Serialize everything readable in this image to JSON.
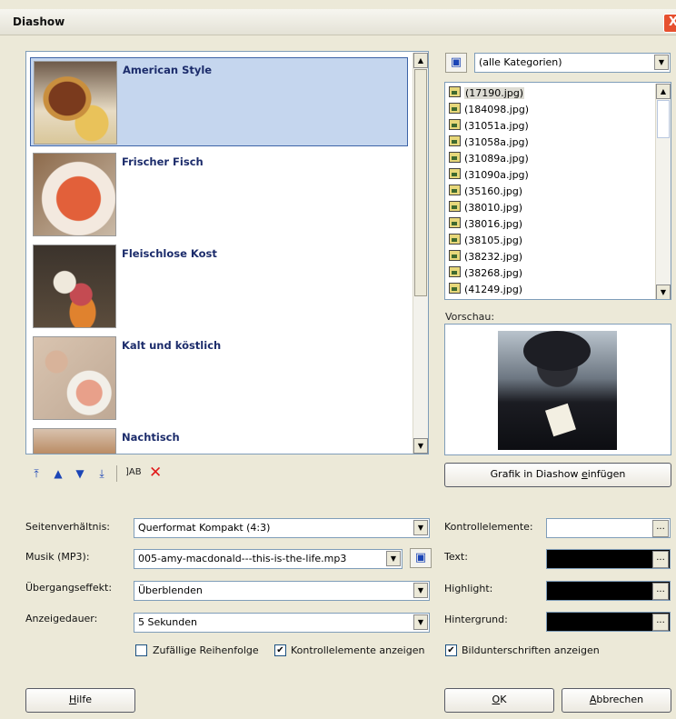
{
  "window": {
    "title": "Diashow",
    "close_glyph": "X"
  },
  "slides": [
    {
      "label": "American Style",
      "selected": true
    },
    {
      "label": "Frischer Fisch",
      "selected": false
    },
    {
      "label": "Fleischlose Kost",
      "selected": false
    },
    {
      "label": "Kalt und köstlich",
      "selected": false
    },
    {
      "label": "Nachtisch",
      "selected": false
    }
  ],
  "list_toolbar": {
    "rename_label": "]AB",
    "delete_label": "✕"
  },
  "category": {
    "selected": "(alle Kategorien)"
  },
  "files": [
    "(17190.jpg)",
    "(184098.jpg)",
    "(31051a.jpg)",
    "(31058a.jpg)",
    "(31089a.jpg)",
    "(31090a.jpg)",
    "(35160.jpg)",
    "(38010.jpg)",
    "(38016.jpg)",
    "(38105.jpg)",
    "(38232.jpg)",
    "(38268.jpg)",
    "(41249.jpg)"
  ],
  "preview": {
    "label": "Vorschau:"
  },
  "insert_button": {
    "pre": "Grafik in Diashow ",
    "underlined": "e",
    "post": "infügen"
  },
  "settings": {
    "aspect_label": "Seitenverhältnis:",
    "aspect_value": "Querformat Kompakt (4:3)",
    "music_label": "Musik (MP3):",
    "music_value": "005-amy-macdonald---this-is-the-life.mp3",
    "transition_label": "Übergangseffekt:",
    "transition_value": "Überblenden",
    "duration_label": "Anzeigedauer:",
    "duration_value": "5 Sekunden"
  },
  "colors_section": {
    "controls_label": "Kontrollelemente:",
    "text_label": "Text:",
    "highlight_label": "Highlight:",
    "background_label": "Hintergrund:",
    "controls_color": "#ffffff",
    "text_color": "#000000",
    "highlight_color": "#000000",
    "background_color": "#000000",
    "dots": "..."
  },
  "options": {
    "random_label": "Zufällige Reihenfolge",
    "random_checked": false,
    "show_controls_label": "Kontrollelemente anzeigen",
    "show_controls_checked": true,
    "show_captions_label": "Bildunterschriften anzeigen",
    "show_captions_checked": true
  },
  "buttons": {
    "help": {
      "underlined": "H",
      "rest": "ilfe"
    },
    "ok": {
      "underlined": "O",
      "rest": "K"
    },
    "cancel": {
      "underlined": "A",
      "rest": "bbrechen"
    }
  }
}
